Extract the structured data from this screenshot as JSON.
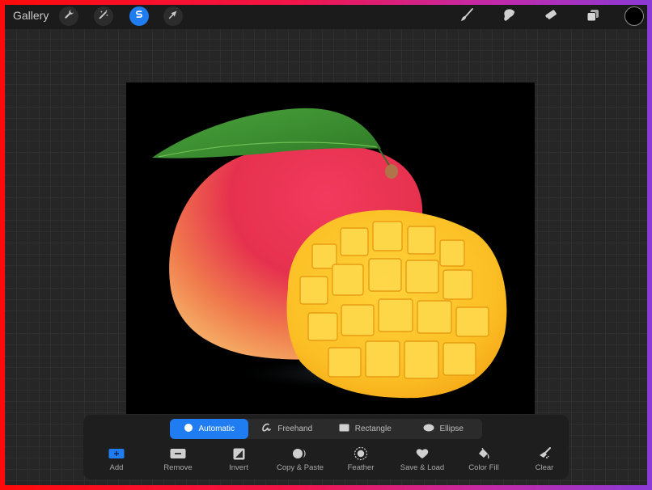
{
  "topbar": {
    "gallery_label": "Gallery",
    "left_tools": [
      {
        "name": "actions",
        "icon": "wrench-icon",
        "active": false
      },
      {
        "name": "adjustments",
        "icon": "magic-wand-icon",
        "active": false
      },
      {
        "name": "selection",
        "icon": "selection-s-icon",
        "active": true
      },
      {
        "name": "transform",
        "icon": "arrow-cursor-icon",
        "active": false
      }
    ],
    "right_tools": [
      {
        "name": "brush",
        "icon": "brush-icon"
      },
      {
        "name": "smudge",
        "icon": "smudge-finger-icon"
      },
      {
        "name": "eraser",
        "icon": "eraser-icon"
      },
      {
        "name": "layers",
        "icon": "layers-icon"
      }
    ],
    "current_color": "#000000",
    "accent_color": "#1f7df1"
  },
  "canvas": {
    "subject": "mango with leaf and cubed half (hedgehog cut)",
    "background": "#000000"
  },
  "selection_panel": {
    "modes": [
      {
        "label": "Automatic",
        "icon": "filled-circle-icon",
        "active": true
      },
      {
        "label": "Freehand",
        "icon": "freehand-scribble-icon",
        "active": false
      },
      {
        "label": "Rectangle",
        "icon": "rectangle-icon",
        "active": false
      },
      {
        "label": "Ellipse",
        "icon": "ellipse-icon",
        "active": false
      }
    ],
    "actions": [
      {
        "label": "Add",
        "icon": "add-plus-icon"
      },
      {
        "label": "Remove",
        "icon": "remove-minus-icon"
      },
      {
        "label": "Invert",
        "icon": "invert-icon"
      },
      {
        "label": "Copy & Paste",
        "icon": "copy-paste-icon"
      },
      {
        "label": "Feather",
        "icon": "feather-icon"
      },
      {
        "label": "Save & Load",
        "icon": "heart-icon"
      },
      {
        "label": "Color Fill",
        "icon": "color-fill-icon"
      },
      {
        "label": "Clear",
        "icon": "clear-brush-icon"
      }
    ]
  }
}
